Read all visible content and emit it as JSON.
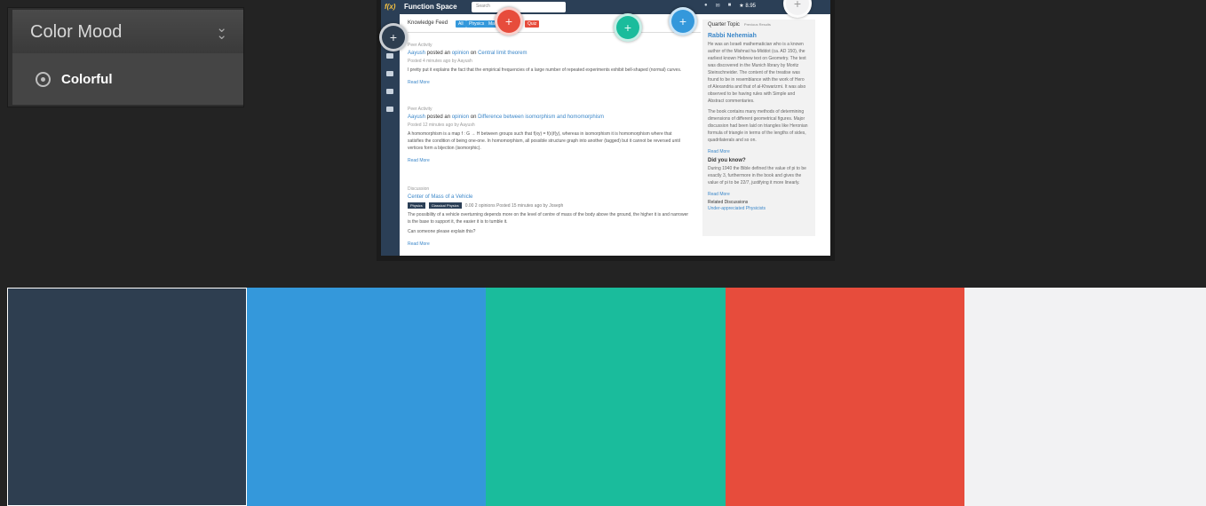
{
  "color_mood": {
    "title": "Color Mood",
    "selected_option": "Colorful"
  },
  "palette": [
    {
      "hex": "#2E3E50",
      "name": "dark-navy"
    },
    {
      "hex": "#3498DB",
      "name": "blue"
    },
    {
      "hex": "#1ABC9C",
      "name": "teal"
    },
    {
      "hex": "#E74C3C",
      "name": "red"
    },
    {
      "hex": "#F2F2F3",
      "name": "light-gray"
    }
  ],
  "source": {
    "brand": "Function Space",
    "logo": "f(x)",
    "search_placeholder": "Search",
    "score": "★ 8.95",
    "knowledge_feed": "Knowledge Feed",
    "filters": [
      "All",
      "Physics",
      "Math",
      "Quiz"
    ],
    "posts": [
      {
        "meta": "Peer Activity",
        "author": "Aayush",
        "verb": " posted an ",
        "kind": "opinion",
        "on": " on ",
        "title": "Central limit theorem",
        "posted": "Posted 4 minutes ago by Aayush",
        "lines": [
          "I pretty put it explains the fact that the empirical frequencies of a large number of repeated experiments exhibit bell-shaped (normal) curves."
        ],
        "read_more": "Read More"
      },
      {
        "meta": "Peer Activity",
        "author": "Aayush",
        "verb": " posted an ",
        "kind": "opinion",
        "on": " on ",
        "title": "Difference between isomorphism and homomorphism",
        "posted": "Posted 12 minutes ago by Aayush",
        "lines": [
          "A homomorphism is a map f : G → H between groups such that f(xy) = f(x)f(y), whereas in isomorphism it is homomorphism where that",
          "satisfies the condition of being one-one. In homomorphism, all possible structure graph into another (tagged) but it cannot be reversed until",
          "vertices form a bijection (isomorphic)."
        ],
        "read_more": "Read More"
      },
      {
        "meta": "Discussion",
        "title": "Center of Mass of a Vehicle",
        "tags": [
          "Physics",
          "Classical Physics"
        ],
        "stats": "0.00    2 opinions    Posted 15 minutes ago by Joseph",
        "lines": [
          "The possibility of a vehicle overturning depends more on the level of centre of mass of the body above the ground, the higher it is and narrower",
          "is the base to support it, the easier it is to tumble it.",
          "Can someone please explain this?"
        ],
        "read_more": "Read More"
      }
    ],
    "sidebar": {
      "title": "Quarter Topic",
      "nav": "Previous Results",
      "topic": "Rabbi Nehemiah",
      "lines": [
        "He was an Israeli mathematician who is a known",
        "author of the Mishnat ha-Middot (ca. AD 150), the",
        "earliest known Hebrew text on Geometry. The text",
        "was discovered in the Munich library by Moritz",
        "Steinschneider. The content of the treatise was",
        "found to be in resemblance with the work of Hero",
        "of Alexandria and that of al-Khwarizmi. It was also",
        "observed to be having rules with Simple and",
        "Abstract commentaries.",
        "",
        "The book contains many methods of determining",
        "dimensions of different geometrical figures. Major",
        "discussion had been laid on triangles like Heronian",
        "formula of triangle in terms of the lengths of sides,",
        "quadrilaterals and so on."
      ],
      "read_more": "Read More",
      "did_you_know": "Did you know?",
      "dyk_lines": [
        "During 1940 the Bible defined the value of pi to be",
        "exactly 3, furthermore in the book and gives the",
        "value of pi to be 22/7, justifying it more linearly."
      ],
      "read_more_2": "Read More",
      "related": "Related Discussions",
      "related_item": "Under-appreciated Physicists"
    }
  }
}
